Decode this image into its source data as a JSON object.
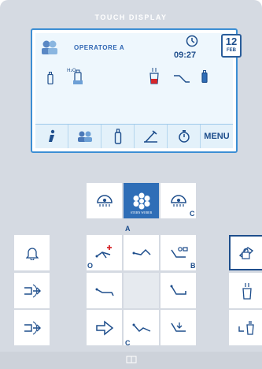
{
  "panel": {
    "title": "TOUCH DISPLAY"
  },
  "screen": {
    "operator": "OPERATORE A",
    "time": "09:27",
    "date_day": "12",
    "date_month": "FEB",
    "bottom_bar": {
      "menu_label": "MENU",
      "buttons": [
        "info-icon",
        "operators-icon",
        "bottle-icon",
        "instrument-icon",
        "timer-icon",
        "menu-button"
      ]
    },
    "status_icons": [
      "operators-icon",
      "bottle-icon",
      "water-bottle-icon",
      "cup-fill-icon",
      "spittoon-icon",
      "bottle-icon"
    ]
  },
  "keypad": {
    "brand_label": "STERN WEBER",
    "hold_marks": [
      "A",
      "O",
      "B",
      "C",
      "C"
    ],
    "buttons": [
      "light-icon",
      "stern-weber-logo-button",
      "light-c-icon",
      "bell-icon",
      "chair-plus-icon",
      "chair-a-icon",
      "chair-settings-icon",
      "chair-lock-button",
      "exit-left-icon",
      "chair-o-icon",
      "chair-b-icon",
      "cup-fill-icon",
      "exit-right-icon",
      "return-icon",
      "chair-c-icon",
      "chair-down-icon",
      "cup-rinse-icon"
    ]
  },
  "colors": {
    "accent": "#2f6eb7",
    "panel": "#d5dae2",
    "screen_border": "#3c8ed4",
    "plus": "#d6262a"
  }
}
